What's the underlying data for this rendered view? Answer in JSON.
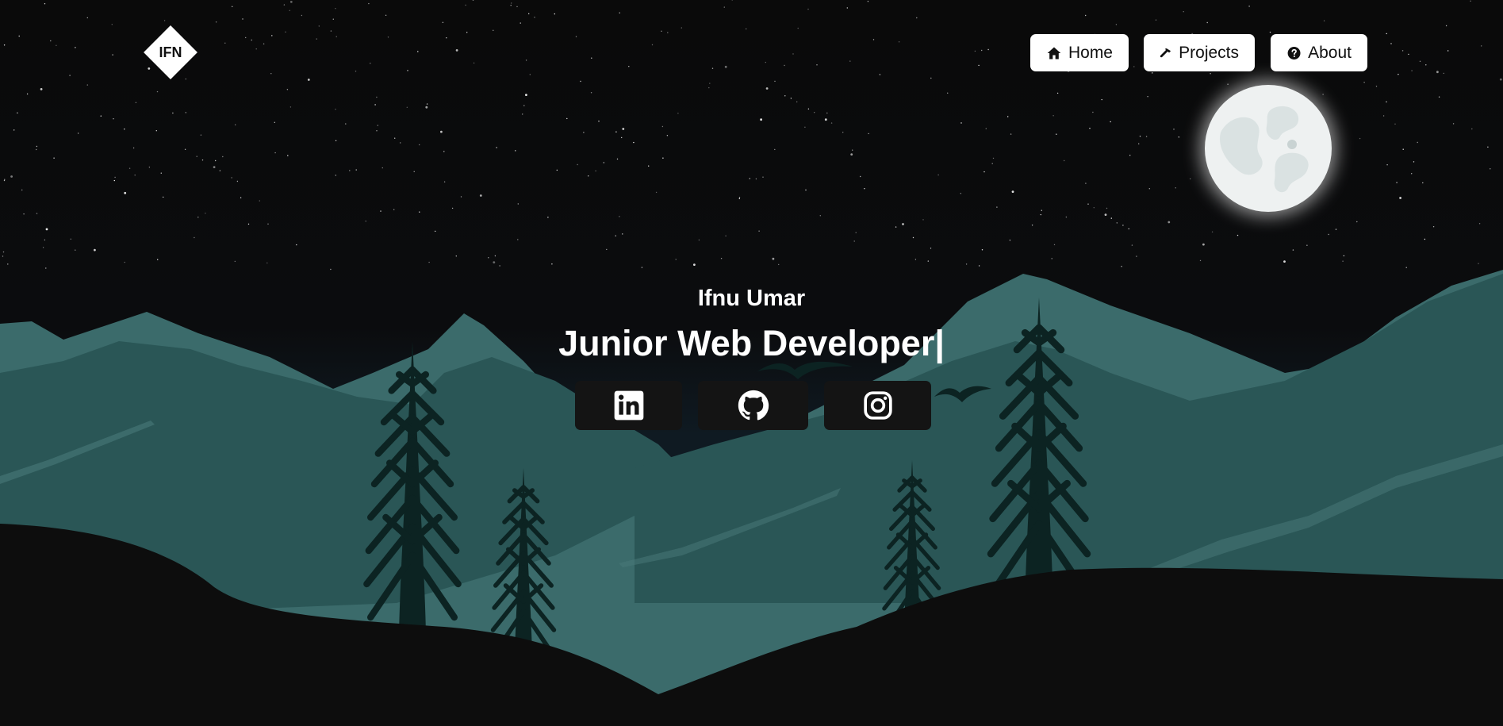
{
  "logo": {
    "text": "IFN"
  },
  "nav": {
    "home": {
      "label": "Home",
      "icon": "home-icon"
    },
    "projects": {
      "label": "Projects",
      "icon": "hammer-icon"
    },
    "about": {
      "label": "About",
      "icon": "question-circle-icon"
    }
  },
  "hero": {
    "name": "Ifnu Umar",
    "role": "Junior Web Developer|"
  },
  "social": [
    {
      "name": "LinkedIn",
      "icon": "linkedin-icon"
    },
    {
      "name": "GitHub",
      "icon": "github-icon"
    },
    {
      "name": "Instagram",
      "icon": "instagram-icon"
    }
  ],
  "colors": {
    "background": "#0b0b0b",
    "mountain_far": "#3b6b6b",
    "mountain_near": "#2a5656",
    "ground": "#0d0d0d",
    "tree": "#0c2322",
    "button_bg": "#ffffff",
    "social_bg": "#141414"
  }
}
